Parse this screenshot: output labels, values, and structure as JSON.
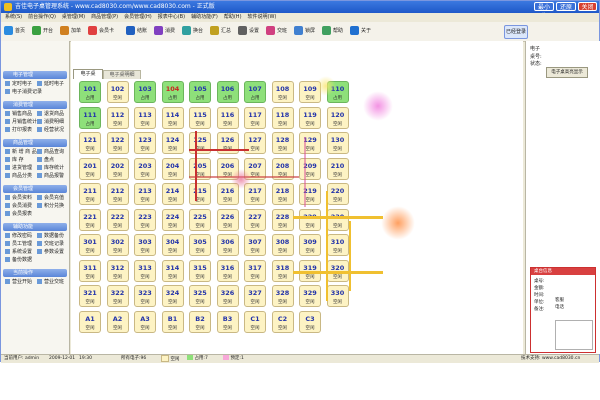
{
  "window": {
    "title": "吉佳电子桌管理系统 - www.cad8030.com/www.cad8030.com - 正式版",
    "minimize": "最小化",
    "restore": "还原",
    "close": "关闭"
  },
  "menu": [
    "系统(S)",
    "前台操作(Q)",
    "桌管理(M)",
    "商品管理(P)",
    "会员管理(H)",
    "报表中心(B)",
    "辅助功能(F)",
    "帮助(H)",
    "软件说明(W)"
  ],
  "toolbar": [
    {
      "label": "首页",
      "color": "#2a8be0"
    },
    {
      "label": "开台",
      "color": "#3aa040"
    },
    {
      "label": "加单",
      "color": "#d08020"
    },
    {
      "label": "会员卡",
      "color": "#e04040"
    },
    {
      "label": "结账",
      "color": "#2060c0"
    },
    {
      "label": "消费",
      "color": "#8040c0"
    },
    {
      "label": "换台",
      "color": "#30a0a0"
    },
    {
      "label": "汇总",
      "color": "#c0a020"
    },
    {
      "label": "设置",
      "color": "#606060"
    },
    {
      "label": "交班",
      "color": "#d04080"
    },
    {
      "label": "锁屏",
      "color": "#4080d0"
    },
    {
      "label": "帮助",
      "color": "#40a060"
    },
    {
      "label": "关于",
      "color": "#2070d0"
    }
  ],
  "toolbar_right": "已经登录",
  "sidebar": {
    "groups": [
      {
        "title": "电子管理",
        "items": [
          "定时电子",
          "延时电子",
          "电子消费记录"
        ]
      },
      {
        "title": "消费管理",
        "items": [
          "销售商品",
          "退货商品",
          "月销售统计",
          "消费明细",
          "打印报表",
          "经营状况"
        ]
      },
      {
        "title": "商品管理",
        "items": [
          "新 增 商 品",
          "商品查询",
          "库 存",
          "盘点",
          "进货管理",
          "库存统计",
          "商品分类",
          "商品报警"
        ]
      },
      {
        "title": "会员管理",
        "items": [
          "会员资料",
          "会员充值",
          "会员消费",
          "积分兑换",
          "会员报表"
        ]
      },
      {
        "title": "辅助功能",
        "items": [
          "修改密码",
          "数据备份",
          "员工管理",
          "交班记录",
          "系统设置",
          "参数设置",
          "备份数据"
        ]
      },
      {
        "title": "当前操作",
        "items": [
          "营业开始",
          "营业交班"
        ]
      }
    ]
  },
  "tabs": [
    "电子桌",
    "电子桌明细"
  ],
  "rooms": [
    [
      "101",
      "102",
      "103",
      "104",
      "105",
      "106",
      "107",
      "108",
      "109",
      "110"
    ],
    [
      "111",
      "112",
      "113",
      "114",
      "115",
      "116",
      "117",
      "118",
      "119",
      "120"
    ],
    [
      "121",
      "122",
      "123",
      "124",
      "125",
      "126",
      "127",
      "128",
      "129",
      "130"
    ],
    [
      "201",
      "202",
      "203",
      "204",
      "205",
      "206",
      "207",
      "208",
      "209",
      "210"
    ],
    [
      "211",
      "212",
      "213",
      "214",
      "215",
      "216",
      "217",
      "218",
      "219",
      "220"
    ],
    [
      "221",
      "222",
      "223",
      "224",
      "225",
      "226",
      "227",
      "228",
      "229",
      "230"
    ],
    [
      "301",
      "302",
      "303",
      "304",
      "305",
      "306",
      "307",
      "308",
      "309",
      "310"
    ],
    [
      "311",
      "312",
      "313",
      "314",
      "315",
      "316",
      "317",
      "318",
      "319",
      "320"
    ],
    [
      "321",
      "322",
      "323",
      "324",
      "325",
      "326",
      "327",
      "328",
      "329",
      "330"
    ],
    [
      "A1",
      "A2",
      "A3",
      "B1",
      "B2",
      "B3",
      "C1",
      "C2",
      "C3"
    ]
  ],
  "busy_rooms": [
    "101",
    "103",
    "104",
    "105",
    "106",
    "107",
    "110",
    "111"
  ],
  "red_rooms": [
    "104"
  ],
  "status_labels": {
    "busy": "占用",
    "free": "空闲"
  },
  "right_pane": {
    "header": "电子",
    "field1": "桌号:",
    "field2": "状态:",
    "button": "电子桌高亮显示",
    "info_title": "桌台信息",
    "info_rows": [
      "桌号:",
      "金额:",
      "时间:",
      "单位:",
      "备注:"
    ],
    "info_val1": "客服",
    "info_val2": "电话"
  },
  "statusbar": {
    "user": "当前用户: admin",
    "date": "2009-12-01",
    "time": "19:30",
    "total": "所有电子:96",
    "legend_free": "空闲",
    "legend_busy": "占用:7",
    "legend_reserve": "预定:1",
    "company": "技术支持: www.cad8030.cn"
  },
  "colors": {
    "free": "#fdf3c4",
    "busy": "#8ee07a",
    "accent": "#2233aa"
  }
}
